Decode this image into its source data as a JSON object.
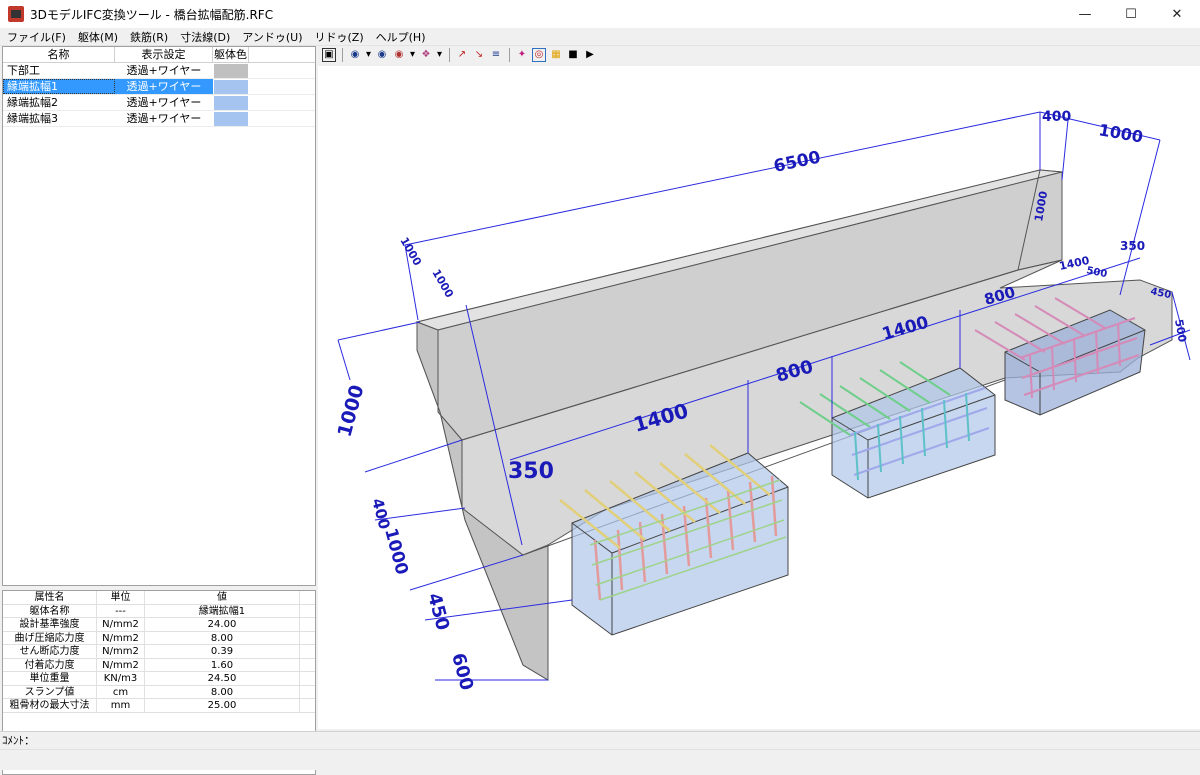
{
  "window": {
    "title": "3DモデルIFC変換ツール - 橋台拡幅配筋.RFC"
  },
  "menu": [
    "ファイル(F)",
    "躯体(M)",
    "鉄筋(R)",
    "寸法線(D)",
    "アンドゥ(U)",
    "リドゥ(Z)",
    "ヘルプ(H)"
  ],
  "tree": {
    "headers": [
      "名称",
      "表示設定",
      "躯体色"
    ],
    "rows": [
      {
        "name": "下部工",
        "display": "透過+ワイヤー",
        "color": "#c0c0c0"
      },
      {
        "name": "縁端拡幅1",
        "display": "透過+ワイヤー",
        "color": "#a6c4f0"
      },
      {
        "name": "縁端拡幅2",
        "display": "透過+ワイヤー",
        "color": "#a6c4f0"
      },
      {
        "name": "縁端拡幅3",
        "display": "透過+ワイヤー",
        "color": "#a6c4f0"
      }
    ],
    "selected_index": 1
  },
  "properties": {
    "headers": [
      "属性名",
      "単位",
      "値"
    ],
    "rows": [
      {
        "name": "躯体名称",
        "unit": "---",
        "value": "縁端拡幅1"
      },
      {
        "name": "設計基準強度",
        "unit": "N/mm2",
        "value": "24.00"
      },
      {
        "name": "曲げ圧縮応力度",
        "unit": "N/mm2",
        "value": "8.00"
      },
      {
        "name": "せん断応力度",
        "unit": "N/mm2",
        "value": "0.39"
      },
      {
        "name": "付着応力度",
        "unit": "N/mm2",
        "value": "1.60"
      },
      {
        "name": "単位重量",
        "unit": "KN/m3",
        "value": "24.50"
      },
      {
        "name": "スランプ値",
        "unit": "cm",
        "value": "8.00"
      },
      {
        "name": "粗骨材の最大寸法",
        "unit": "mm",
        "value": "25.00"
      }
    ]
  },
  "dimensions": {
    "top_total": "6500",
    "top_r1": "400",
    "top_r2": "1000",
    "seg1": "350",
    "seg2": "1400",
    "seg3": "800",
    "seg4": "1400",
    "seg5": "800",
    "left_h1": "1000",
    "left_h2": "400",
    "left_h3": "1000",
    "left_h4": "450",
    "left_h5": "600",
    "right_h": "1000",
    "right_a": "350",
    "right_b": "1400",
    "right_c": "500",
    "right_d": "450",
    "right_e": "500",
    "top_left_a": "1000",
    "top_left_b": "1000"
  },
  "status": {
    "comment_label": "ｺﾒﾝﾄ："
  }
}
